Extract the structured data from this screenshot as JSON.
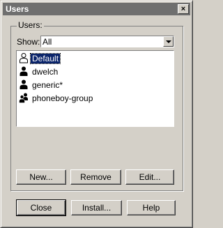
{
  "window": {
    "title": "Users",
    "close_glyph": "×"
  },
  "group": {
    "label": "Users:",
    "show_label": "Show:",
    "show_value": "All",
    "items": [
      {
        "label": "Default",
        "icon": "user-outline-icon",
        "selected": true
      },
      {
        "label": "dwelch",
        "icon": "user-icon",
        "selected": false
      },
      {
        "label": "generic*",
        "icon": "user-icon",
        "selected": false
      },
      {
        "label": "phoneboy-group",
        "icon": "user-group-icon",
        "selected": false
      }
    ],
    "buttons": {
      "new": "New...",
      "remove": "Remove",
      "edit": "Edit..."
    }
  },
  "footer": {
    "close": "Close",
    "install": "Install...",
    "help": "Help"
  }
}
